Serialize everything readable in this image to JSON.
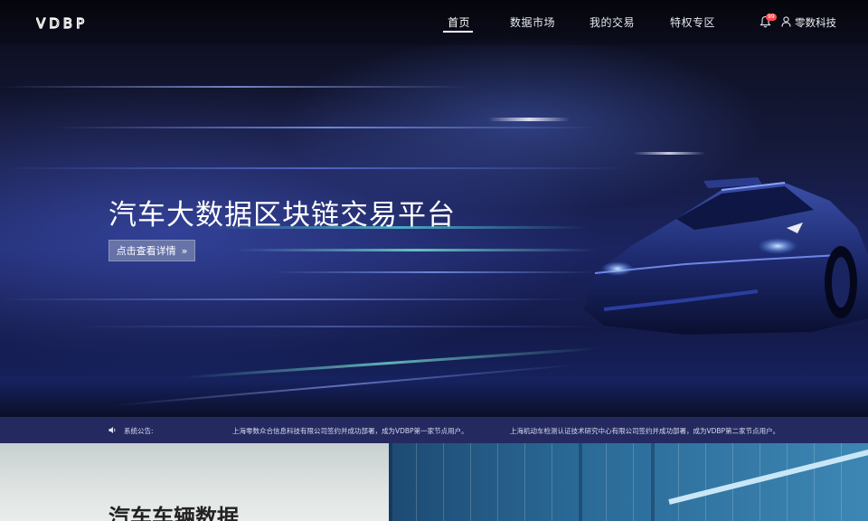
{
  "nav": {
    "logo_text": "VDBP",
    "items": [
      {
        "label": "首页",
        "active": true
      },
      {
        "label": "数据市场",
        "active": false
      },
      {
        "label": "我的交易",
        "active": false
      },
      {
        "label": "特权专区",
        "active": false
      }
    ],
    "notification_count": "99",
    "user_name": "零数科技"
  },
  "hero": {
    "title": "汽车大数据区块链交易平台",
    "button_label": "点击查看详情",
    "button_arrow": "»"
  },
  "notice": {
    "label": "系统公告:",
    "messages": [
      "上海零数众合信息科技有限公司签约并成功部署，成为VDBP第一家节点用户。",
      "上海机动车检测认证技术研究中心有限公司签约并成功部署，成为VDBP第二家节点用户。"
    ]
  },
  "section2": {
    "title": "汽车车辆数据"
  },
  "icons": {
    "bell": "bell-icon",
    "user": "user-icon",
    "speaker": "speaker-icon",
    "arrow": "double-chevron-right-icon"
  },
  "colors": {
    "notice_bar": "#242a60",
    "badge": "#ff4b4b",
    "hero_button": "#8e95ad"
  }
}
